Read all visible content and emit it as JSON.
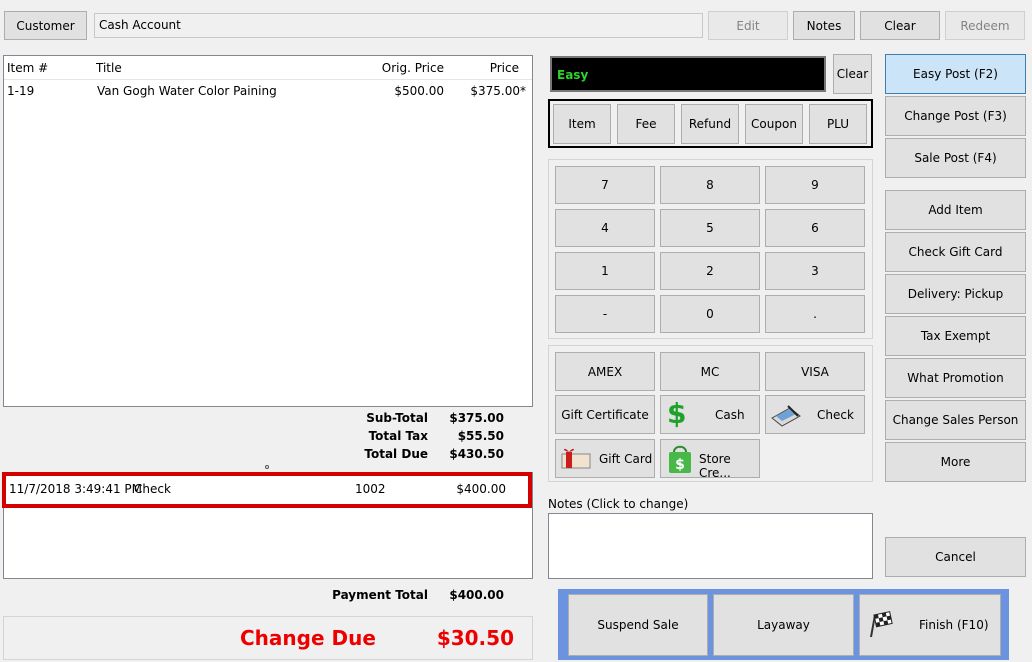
{
  "top": {
    "customer_label": "Customer",
    "customer_value": "Cash Account",
    "edit_label": "Edit",
    "notes_label": "Notes",
    "clear_label": "Clear",
    "redeem_label": "Redeem"
  },
  "items_table": {
    "columns": [
      "Item #",
      "Title",
      "Orig. Price",
      "Price"
    ],
    "rows": [
      {
        "item_no": "1-19",
        "title": "Van Gogh Water Color Paining",
        "orig_price": "$500.00",
        "price": "$375.00*"
      }
    ]
  },
  "totals": {
    "subtotal_label": "Sub-Total",
    "subtotal_value": "$375.00",
    "tax_label": "Total Tax",
    "tax_value": "$55.50",
    "due_label": "Total Due",
    "due_value": "$430.50"
  },
  "payments": {
    "rows": [
      {
        "datetime": "11/7/2018 3:49:41 PM",
        "method": "Check",
        "ref": "1002",
        "amount": "$400.00"
      }
    ],
    "total_label": "Payment Total",
    "total_value": "$400.00"
  },
  "change": {
    "label": "Change Due",
    "value": "$30.50"
  },
  "entry": {
    "mode_text": "Easy",
    "clear_label": "Clear",
    "type_buttons": [
      "Item",
      "Fee",
      "Refund",
      "Coupon",
      "PLU"
    ]
  },
  "keypad": [
    "7",
    "8",
    "9",
    "4",
    "5",
    "6",
    "1",
    "2",
    "3",
    "-",
    "0",
    "."
  ],
  "tenders": {
    "amex": "AMEX",
    "mc": "MC",
    "visa": "VISA",
    "gift_certificate": "Gift Certificate",
    "cash": "Cash",
    "check": "Check",
    "gift_card": "Gift Card",
    "store_credit": "Store Cre..."
  },
  "notes": {
    "label": "Notes (Click to change)",
    "value": ""
  },
  "right_buttons": {
    "easy_post": "Easy Post (F2)",
    "change_post": "Change Post (F3)",
    "sale_post": "Sale Post (F4)",
    "add_item": "Add Item",
    "check_gift_card": "Check Gift Card",
    "delivery": "Delivery: Pickup",
    "tax_exempt": "Tax Exempt",
    "what_promotion": "What Promotion",
    "change_sales_person": "Change Sales Person",
    "more": "More",
    "cancel": "Cancel"
  },
  "bottom_actions": {
    "suspend": "Suspend Sale",
    "layaway": "Layaway",
    "finish": "Finish (F10)"
  },
  "colors": {
    "accent_blue": "#6b93e0",
    "highlight_red": "#d40000",
    "change_red": "#ee0000",
    "mode_green": "#2bd52b"
  }
}
